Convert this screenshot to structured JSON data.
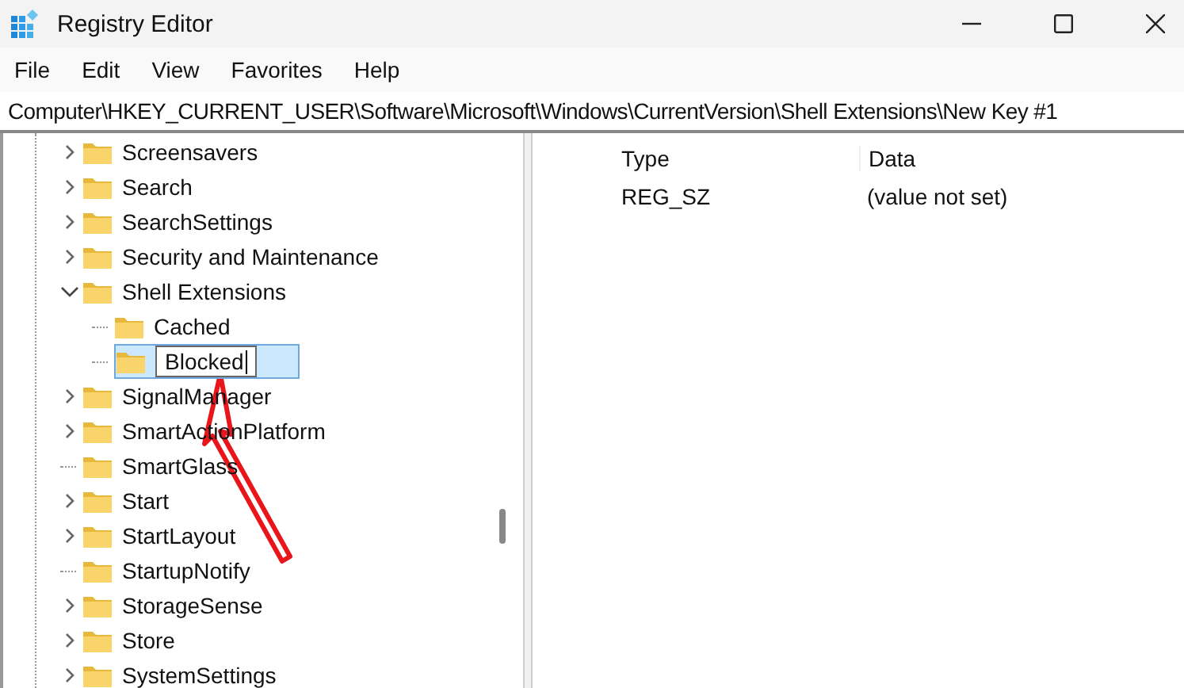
{
  "window": {
    "title": "Registry Editor"
  },
  "menu": [
    {
      "label": "File"
    },
    {
      "label": "Edit"
    },
    {
      "label": "View"
    },
    {
      "label": "Favorites"
    },
    {
      "label": "Help"
    }
  ],
  "address": "Computer\\HKEY_CURRENT_USER\\Software\\Microsoft\\Windows\\CurrentVersion\\Shell Extensions\\New Key #1",
  "tree": [
    {
      "name": "Screensavers",
      "kind": "branch",
      "expanded": false
    },
    {
      "name": "Search",
      "kind": "branch",
      "expanded": false
    },
    {
      "name": "SearchSettings",
      "kind": "branch",
      "expanded": false
    },
    {
      "name": "Security and Maintenance",
      "kind": "branch",
      "expanded": false
    },
    {
      "name": "Shell Extensions",
      "kind": "branch",
      "expanded": true,
      "children": [
        {
          "name": "Cached",
          "kind": "leaf"
        },
        {
          "name": "Blocked",
          "kind": "leaf",
          "selected": true,
          "editing": true
        }
      ]
    },
    {
      "name": "SignalManager",
      "kind": "branch",
      "expanded": false
    },
    {
      "name": "SmartActionPlatform",
      "kind": "branch",
      "expanded": false
    },
    {
      "name": "SmartGlass",
      "kind": "leaf"
    },
    {
      "name": "Start",
      "kind": "branch",
      "expanded": false
    },
    {
      "name": "StartLayout",
      "kind": "branch",
      "expanded": false
    },
    {
      "name": "StartupNotify",
      "kind": "leaf"
    },
    {
      "name": "StorageSense",
      "kind": "branch",
      "expanded": false
    },
    {
      "name": "Store",
      "kind": "branch",
      "expanded": false
    },
    {
      "name": "SystemSettings",
      "kind": "branch",
      "expanded": false
    }
  ],
  "values": {
    "columns": [
      "Type",
      "Data"
    ],
    "rows": [
      [
        "REG_SZ",
        "(value not set)"
      ]
    ]
  }
}
